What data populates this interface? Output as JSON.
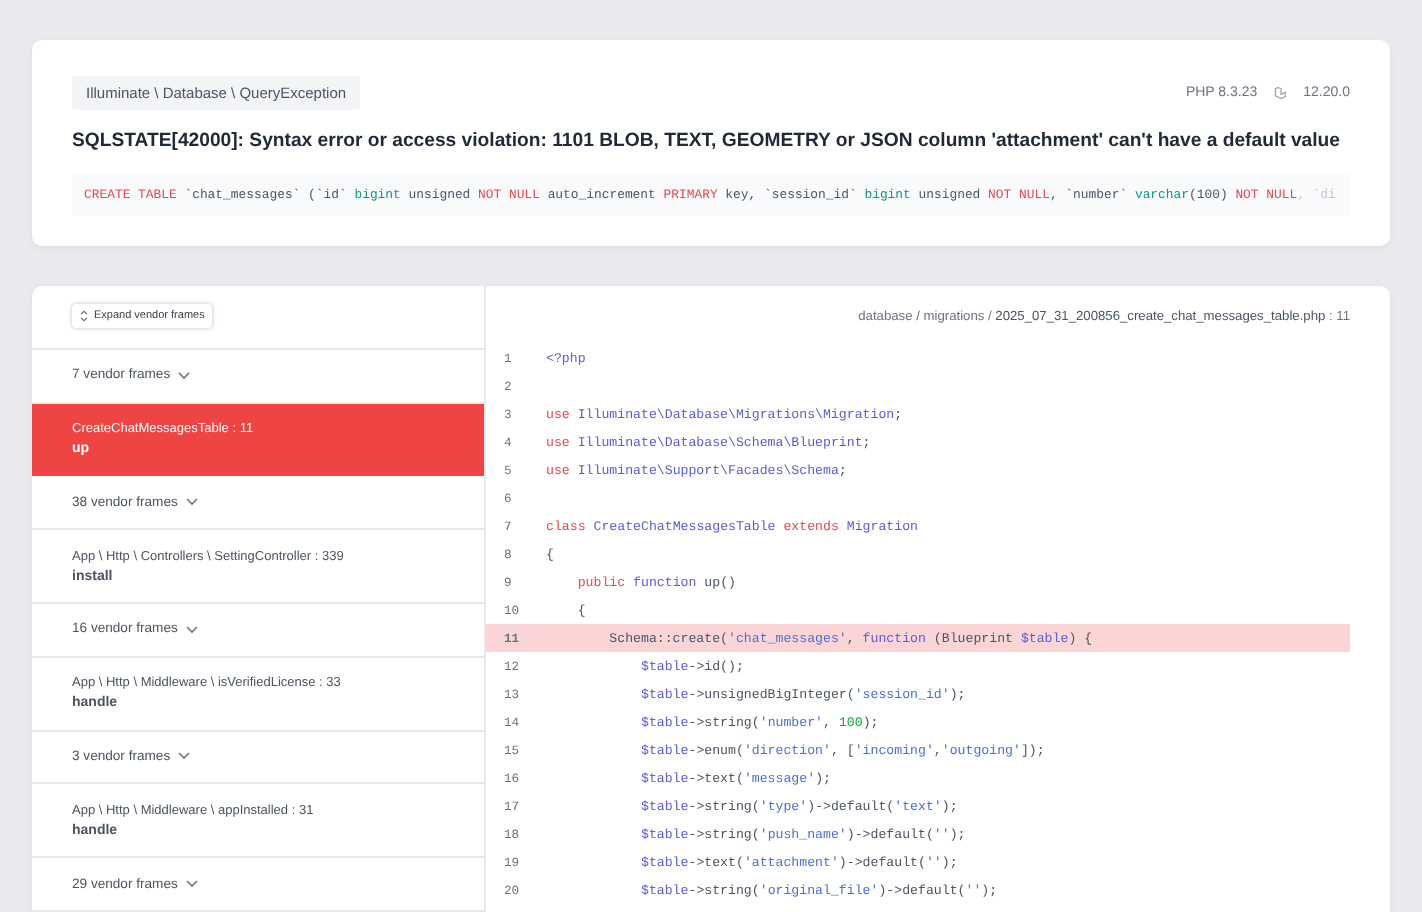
{
  "header": {
    "exception_class": "Illuminate \\ Database \\ QueryException",
    "php_version": "PHP 8.3.23",
    "laravel_version": "12.20.0",
    "message": "SQLSTATE[42000]: Syntax error or access violation: 1101 BLOB, TEXT, GEOMETRY or JSON column 'attachment' can't have a default value",
    "sql": [
      {
        "text": "CREATE TABLE",
        "kind": "keyword"
      },
      {
        "text": " `chat_messages` (`id` ",
        "kind": "plain"
      },
      {
        "text": "bigint",
        "kind": "type"
      },
      {
        "text": " unsigned ",
        "kind": "plain"
      },
      {
        "text": "NOT NULL",
        "kind": "keyword"
      },
      {
        "text": " auto_increment ",
        "kind": "plain"
      },
      {
        "text": "PRIMARY",
        "kind": "keyword"
      },
      {
        "text": " key, `session_id` ",
        "kind": "plain"
      },
      {
        "text": "bigint",
        "kind": "type"
      },
      {
        "text": " unsigned ",
        "kind": "plain"
      },
      {
        "text": "NOT NULL",
        "kind": "keyword"
      },
      {
        "text": ", `number` ",
        "kind": "plain"
      },
      {
        "text": "varchar",
        "kind": "type"
      },
      {
        "text": "(100) ",
        "kind": "plain"
      },
      {
        "text": "NOT NULL",
        "kind": "keyword"
      },
      {
        "text": ", `di",
        "kind": "faded"
      }
    ]
  },
  "expand_button": "Expand vendor frames",
  "frames": [
    {
      "kind": "vendor",
      "label": "7 vendor frames"
    },
    {
      "kind": "app",
      "location": "CreateChatMessagesTable : 11",
      "method": "up",
      "selected": true
    },
    {
      "kind": "vendor",
      "label": "38 vendor frames"
    },
    {
      "kind": "app",
      "location": "App \\ Http \\ Controllers \\ SettingController : 339",
      "method": "install",
      "selected": false
    },
    {
      "kind": "vendor",
      "label": "16 vendor frames"
    },
    {
      "kind": "app",
      "location": "App \\ Http \\ Middleware \\ isVerifiedLicense : 33",
      "method": "handle",
      "selected": false
    },
    {
      "kind": "vendor",
      "label": "3 vendor frames"
    },
    {
      "kind": "app",
      "location": "App \\ Http \\ Middleware \\ appInstalled : 31",
      "method": "handle",
      "selected": false
    },
    {
      "kind": "vendor",
      "label": "29 vendor frames"
    }
  ],
  "file": {
    "dir": "database / migrations / ",
    "name": "2025_07_31_200856_create_chat_messages_table.php",
    "line": " : 11"
  },
  "code": [
    {
      "number": "1",
      "selected": false,
      "tokens": [
        {
          "text": "<?php",
          "kind": "name"
        }
      ]
    },
    {
      "number": "2",
      "selected": false
    },
    {
      "number": "3",
      "selected": false,
      "tokens": [
        {
          "text": "use",
          "kind": "keyword"
        },
        {
          "text": " Illuminate\\Database\\Migrations\\Migration",
          "kind": "name"
        },
        {
          "text": ";",
          "kind": "plain"
        }
      ]
    },
    {
      "number": "4",
      "selected": false,
      "tokens": [
        {
          "text": "use",
          "kind": "keyword"
        },
        {
          "text": " Illuminate\\Database\\Schema\\Blueprint",
          "kind": "name"
        },
        {
          "text": ";",
          "kind": "plain"
        }
      ]
    },
    {
      "number": "5",
      "selected": false,
      "tokens": [
        {
          "text": "use",
          "kind": "keyword"
        },
        {
          "text": " Illuminate\\Support\\Facades\\Schema",
          "kind": "name"
        },
        {
          "text": ";",
          "kind": "plain"
        }
      ]
    },
    {
      "number": "6",
      "selected": false
    },
    {
      "number": "7",
      "selected": false,
      "tokens": [
        {
          "text": "class",
          "kind": "keyword"
        },
        {
          "text": " CreateChatMessagesTable",
          "kind": "name"
        },
        {
          "text": " extends",
          "kind": "keyword"
        },
        {
          "text": " Migration",
          "kind": "name"
        }
      ]
    },
    {
      "number": "8",
      "selected": false,
      "tokens": [
        {
          "text": "{",
          "kind": "plain"
        }
      ]
    },
    {
      "number": "9",
      "selected": false,
      "tokens": [
        {
          "text": "    public",
          "kind": "keyword"
        },
        {
          "text": " function",
          "kind": "name"
        },
        {
          "text": " up()",
          "kind": "plain"
        }
      ]
    },
    {
      "number": "10",
      "selected": false,
      "tokens": [
        {
          "text": "    {",
          "kind": "plain"
        }
      ]
    },
    {
      "number": "11",
      "selected": true,
      "tokens": [
        {
          "text": "        Schema::create(",
          "kind": "plain"
        },
        {
          "text": "'chat_messages'",
          "kind": "string"
        },
        {
          "text": ", ",
          "kind": "plain"
        },
        {
          "text": "function",
          "kind": "name"
        },
        {
          "text": " (Blueprint ",
          "kind": "plain"
        },
        {
          "text": "$table",
          "kind": "name"
        },
        {
          "text": ") {",
          "kind": "plain"
        }
      ]
    },
    {
      "number": "12",
      "selected": false,
      "tokens": [
        {
          "text": "            $table",
          "kind": "name"
        },
        {
          "text": "->id();",
          "kind": "plain"
        }
      ]
    },
    {
      "number": "13",
      "selected": false,
      "tokens": [
        {
          "text": "            $table",
          "kind": "name"
        },
        {
          "text": "->unsignedBigInteger(",
          "kind": "plain"
        },
        {
          "text": "'session_id'",
          "kind": "string"
        },
        {
          "text": ");",
          "kind": "plain"
        }
      ]
    },
    {
      "number": "14",
      "selected": false,
      "tokens": [
        {
          "text": "            $table",
          "kind": "name"
        },
        {
          "text": "->string(",
          "kind": "plain"
        },
        {
          "text": "'number'",
          "kind": "string"
        },
        {
          "text": ", ",
          "kind": "plain"
        },
        {
          "text": "100",
          "kind": "number"
        },
        {
          "text": ");",
          "kind": "plain"
        }
      ]
    },
    {
      "number": "15",
      "selected": false,
      "tokens": [
        {
          "text": "            $table",
          "kind": "name"
        },
        {
          "text": "->enum(",
          "kind": "plain"
        },
        {
          "text": "'direction'",
          "kind": "string"
        },
        {
          "text": ", [",
          "kind": "plain"
        },
        {
          "text": "'incoming'",
          "kind": "string"
        },
        {
          "text": ",",
          "kind": "plain"
        },
        {
          "text": "'outgoing'",
          "kind": "string"
        },
        {
          "text": "]);",
          "kind": "plain"
        }
      ]
    },
    {
      "number": "16",
      "selected": false,
      "tokens": [
        {
          "text": "            $table",
          "kind": "name"
        },
        {
          "text": "->text(",
          "kind": "plain"
        },
        {
          "text": "'message'",
          "kind": "string"
        },
        {
          "text": ");",
          "kind": "plain"
        }
      ]
    },
    {
      "number": "17",
      "selected": false,
      "tokens": [
        {
          "text": "            $table",
          "kind": "name"
        },
        {
          "text": "->string(",
          "kind": "plain"
        },
        {
          "text": "'type'",
          "kind": "string"
        },
        {
          "text": ")->default(",
          "kind": "plain"
        },
        {
          "text": "'text'",
          "kind": "string"
        },
        {
          "text": ");",
          "kind": "plain"
        }
      ]
    },
    {
      "number": "18",
      "selected": false,
      "tokens": [
        {
          "text": "            $table",
          "kind": "name"
        },
        {
          "text": "->string(",
          "kind": "plain"
        },
        {
          "text": "'push_name'",
          "kind": "string"
        },
        {
          "text": ")->default(",
          "kind": "plain"
        },
        {
          "text": "''",
          "kind": "string"
        },
        {
          "text": ");",
          "kind": "plain"
        }
      ]
    },
    {
      "number": "19",
      "selected": false,
      "tokens": [
        {
          "text": "            $table",
          "kind": "name"
        },
        {
          "text": "->text(",
          "kind": "plain"
        },
        {
          "text": "'attachment'",
          "kind": "string"
        },
        {
          "text": ")->default(",
          "kind": "plain"
        },
        {
          "text": "''",
          "kind": "string"
        },
        {
          "text": ");",
          "kind": "plain"
        }
      ]
    },
    {
      "number": "20",
      "selected": false,
      "tokens": [
        {
          "text": "            $table",
          "kind": "name"
        },
        {
          "text": "->string(",
          "kind": "plain"
        },
        {
          "text": "'original_file'",
          "kind": "string"
        },
        {
          "text": ")->default(",
          "kind": "plain"
        },
        {
          "text": "''",
          "kind": "string"
        },
        {
          "text": ");",
          "kind": "plain"
        }
      ]
    }
  ]
}
